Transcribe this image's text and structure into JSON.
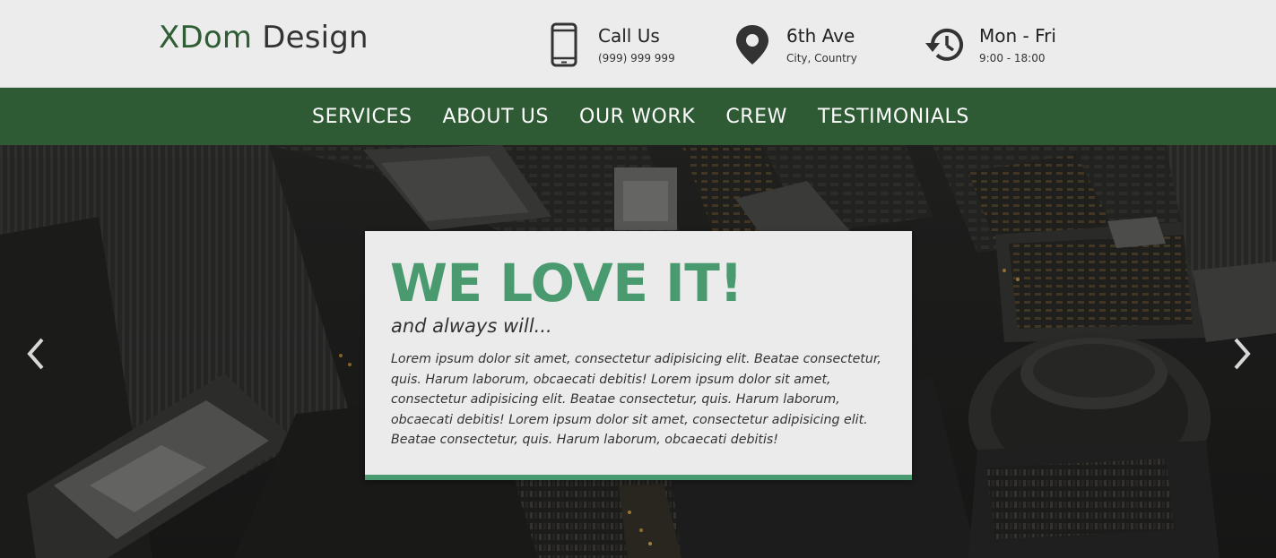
{
  "brand": {
    "logo_part1": "XDom",
    "logo_part2": " Design"
  },
  "contact": {
    "call": {
      "title": "Call Us",
      "detail": "(999) 999 999",
      "icon": "phone-icon"
    },
    "address": {
      "title": "6th Ave",
      "detail": "City, Country",
      "icon": "map-pin-icon"
    },
    "hours": {
      "title": "Mon - Fri",
      "detail": "9:00 - 18:00",
      "icon": "history-clock-icon"
    }
  },
  "nav": {
    "items": [
      {
        "label": "SERVICES"
      },
      {
        "label": "ABOUT US"
      },
      {
        "label": "OUR WORK"
      },
      {
        "label": "CREW"
      },
      {
        "label": "TESTIMONIALS"
      }
    ]
  },
  "hero": {
    "title": "WE LOVE IT!",
    "subtitle": "and always will...",
    "body": "Lorem ipsum dolor sit amet, consectetur adipisicing elit. Beatae consectetur, quis. Harum laborum, obcaecati debitis! Lorem ipsum dolor sit amet, consectetur adipisicing elit. Beatae consectetur, quis. Harum laborum, obcaecati debitis! Lorem ipsum dolor sit amet, consectetur adipisicing elit. Beatae consectetur, quis. Harum laborum, obcaecati debitis!",
    "prev_icon": "chevron-left-icon",
    "next_icon": "chevron-right-icon"
  },
  "colors": {
    "brand_green": "#2e5b34",
    "accent_green": "#4a9a6f",
    "header_bg": "#ececec"
  }
}
